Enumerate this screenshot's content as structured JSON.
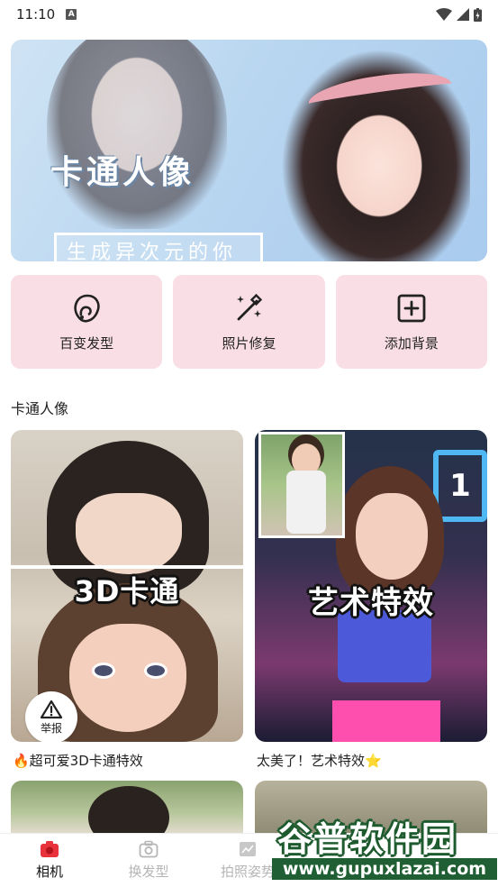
{
  "status_bar": {
    "time": "11:10",
    "notif": "A"
  },
  "banner": {
    "title": "卡通人像",
    "subtitle": "生成异次元的你",
    "active_dot": 0,
    "dot_count": 3
  },
  "features": [
    {
      "label": "百变发型",
      "icon": "hairstyle-icon"
    },
    {
      "label": "照片修复",
      "icon": "magic-wand-icon"
    },
    {
      "label": "添加背景",
      "icon": "add-square-icon"
    }
  ],
  "section": {
    "title": "卡通人像"
  },
  "cards": [
    {
      "tag": "3D卡通",
      "caption": "🔥超可爱3D卡通特效",
      "report_label": "举报"
    },
    {
      "tag": "艺术特效",
      "caption": "太美了！艺术特效⭐",
      "sign_text": "1"
    }
  ],
  "tabbar": {
    "items": [
      {
        "label": "相机",
        "icon": "camera-icon",
        "active": true
      },
      {
        "label": "换发型",
        "icon": "camera-outline-icon",
        "active": false
      },
      {
        "label": "拍照姿势",
        "icon": "image-icon",
        "active": false
      }
    ]
  },
  "watermark": {
    "logo": "谷普软件园",
    "url": "www.gupuxlazai.com"
  },
  "colors": {
    "accent": "#ef4b60",
    "feature_bg": "#f9dfe5",
    "watermark_green": "#1f5f33"
  }
}
